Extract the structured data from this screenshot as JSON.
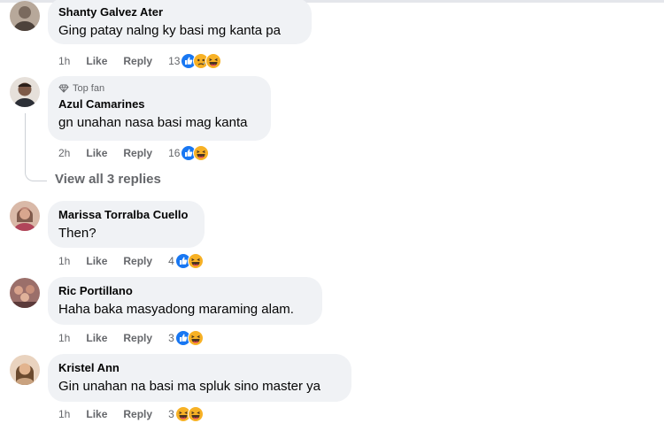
{
  "comments": [
    {
      "author": "Shanty Galvez Ater",
      "text": "Ging patay nalng ky basi mg kanta pa",
      "time": "1h",
      "like_label": "Like",
      "reply_label": "Reply",
      "reaction_count": "13",
      "reactions": [
        "like-reaction-icon",
        "sad-reaction-icon",
        "haha-reaction-icon"
      ],
      "avatar_color": "#b7a89a"
    },
    {
      "badge": "Top fan",
      "author": "Azul Camarines",
      "text": "gn unahan nasa basi mag kanta",
      "time": "2h",
      "like_label": "Like",
      "reply_label": "Reply",
      "reaction_count": "16",
      "reactions": [
        "like-reaction-icon",
        "haha-reaction-icon"
      ],
      "avatar_color": "#5a4a44"
    },
    {
      "author": "Marissa Torralba Cuello",
      "text": "Then?",
      "time": "1h",
      "like_label": "Like",
      "reply_label": "Reply",
      "reaction_count": "4",
      "reactions": [
        "like-reaction-icon",
        "haha-reaction-icon"
      ],
      "avatar_color": "#c28a7b"
    },
    {
      "author": "Ric Portillano",
      "text": "Haha baka masyadong maraming alam.",
      "time": "1h",
      "like_label": "Like",
      "reply_label": "Reply",
      "reaction_count": "3",
      "reactions": [
        "like-reaction-icon",
        "haha-reaction-icon"
      ],
      "avatar_color": "#8a5a56"
    },
    {
      "author": "Kristel Ann",
      "text": "Gin unahan na basi ma spluk sino master ya",
      "time": "1h",
      "like_label": "Like",
      "reply_label": "Reply",
      "reaction_count": "3",
      "reactions": [
        "haha-reaction-icon",
        "haha-reaction-icon"
      ],
      "avatar_color": "#c9a27f"
    }
  ],
  "view_replies_label": "View all 3 replies",
  "colors": {
    "bubble": "#f0f2f5",
    "meta_text": "#65676b",
    "like_blue": "#1877f2",
    "haha_yellow": "#f7b125"
  }
}
